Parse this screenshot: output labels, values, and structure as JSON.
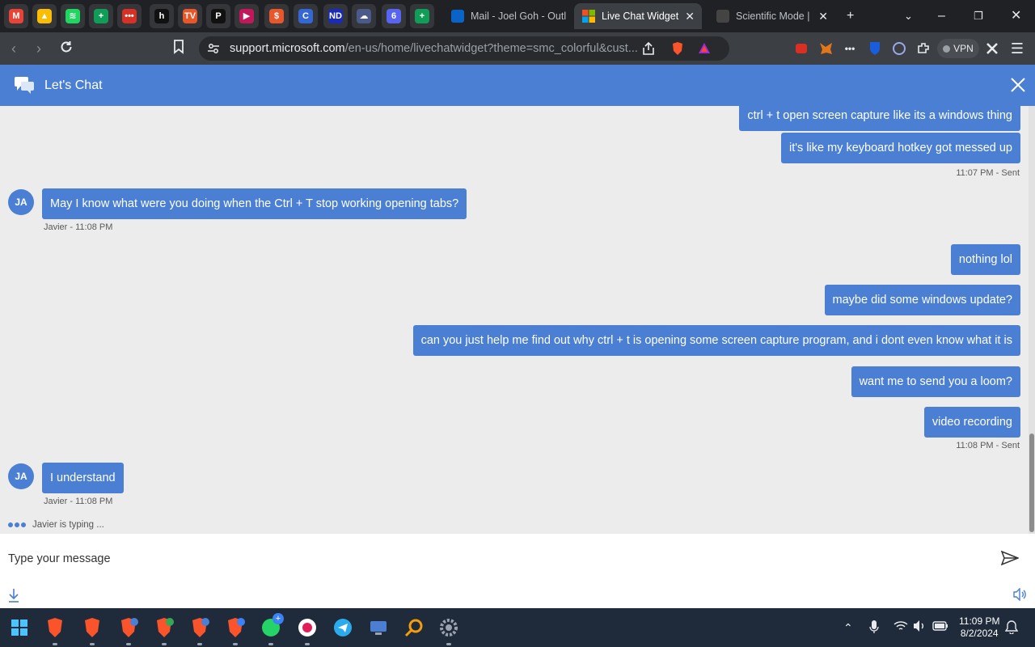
{
  "browser": {
    "pinned_tabs": [
      {
        "name": "gmail-icon",
        "glyph": "M",
        "color": "#ea4335"
      },
      {
        "name": "google-drive-icon",
        "glyph": "▲",
        "color": "#fbbc04"
      },
      {
        "name": "spotify-icon",
        "glyph": "≋",
        "color": "#1ed760"
      },
      {
        "name": "google-sheets-icon",
        "glyph": "+",
        "color": "#0f9d58"
      },
      {
        "name": "app-red-icon",
        "glyph": "•••",
        "color": "#d93025"
      },
      {
        "name": "h-app-icon",
        "glyph": "h",
        "color": "#111111"
      },
      {
        "name": "tv-app-icon",
        "glyph": "TV",
        "color": "#e8562a"
      },
      {
        "name": "p-app-icon",
        "glyph": "P",
        "color": "#111111"
      },
      {
        "name": "play-app-icon",
        "glyph": "▶",
        "color": "#c2185b"
      },
      {
        "name": "shop-bag-icon",
        "glyph": "$",
        "color": "#e8562a"
      },
      {
        "name": "c-app-icon",
        "glyph": "C",
        "color": "#3367d6"
      },
      {
        "name": "nd-app-icon",
        "glyph": "ND",
        "color": "#1a2bb8"
      },
      {
        "name": "cloud-app-icon",
        "glyph": "☁",
        "color": "#4a5a8a"
      },
      {
        "name": "notify-app-icon",
        "glyph": "6",
        "color": "#5865f2"
      },
      {
        "name": "sheets-2-icon",
        "glyph": "+",
        "color": "#0f9d58"
      }
    ],
    "tabs": [
      {
        "title": "Mail - Joel Goh - Outl",
        "fav_color": "#0a64c8"
      },
      {
        "title": "Live Chat Widget",
        "fav_color": "#f25022"
      },
      {
        "title": "Scientific Mode |",
        "fav_color": "#444444"
      }
    ],
    "url_host": "support.microsoft.com",
    "url_rest": "/en-us/home/livechatwidget?theme=smc_colorful&cust...",
    "vpn_label": "VPN"
  },
  "chat": {
    "title": "Let's Chat",
    "messages": [
      {
        "from": "user",
        "text": "ctrl + t open screen capture like its a windows thing"
      },
      {
        "from": "user",
        "text": "it's like my keyboard hotkey got messed up"
      },
      {
        "meta": "11:07 PM - Sent",
        "align": "right"
      },
      {
        "from": "agent",
        "initials": "JA",
        "text": "May I know what were you doing when the Ctrl + T stop working opening tabs?"
      },
      {
        "meta": "Javier - 11:08 PM",
        "align": "left"
      },
      {
        "from": "user",
        "text": "nothing lol"
      },
      {
        "from": "user",
        "text": "maybe did some windows update?"
      },
      {
        "from": "user",
        "text": "can you just help me find out why ctrl + t is opening some screen capture program, and i dont even know what it is"
      },
      {
        "from": "user",
        "text": "want me to send you a loom?"
      },
      {
        "from": "user",
        "text": "video recording"
      },
      {
        "meta": "11:08 PM - Sent",
        "align": "right"
      },
      {
        "from": "agent",
        "initials": "JA",
        "text": "I understand"
      },
      {
        "meta": "Javier - 11:08 PM",
        "align": "left"
      }
    ],
    "typing": "Javier is typing ...",
    "input_placeholder": "Type your message"
  },
  "taskbar": {
    "time": "11:09 PM",
    "date": "8/2/2024",
    "whatsapp_badge": "+"
  }
}
